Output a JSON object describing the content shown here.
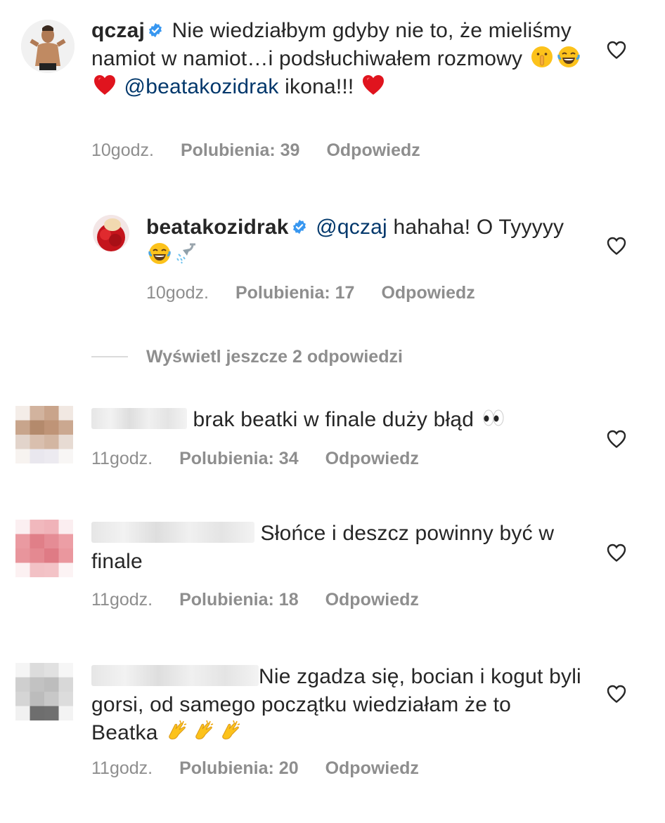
{
  "comments": [
    {
      "username": "qczaj",
      "text_before": " Nie wiedziałbym gdyby nie to, że mieliśmy namiot w namiot…i podsłuchiwałem rozmowy ",
      "mention": "@beatakozidrak",
      "text_after": " ikona!!! ",
      "time": "10godz.",
      "likes": "Polubienia: 39",
      "reply": "Odpowiedz"
    },
    {
      "username": "beatakozidrak",
      "mention": "@qczaj",
      "text_after": " hahaha! O Tyyyyy",
      "time": "10godz.",
      "likes": "Polubienia: 17",
      "reply": "Odpowiedz"
    },
    {
      "text": "brak beatki w finale duży błąd ",
      "time": "11godz.",
      "likes": "Polubienia: 34",
      "reply": "Odpowiedz"
    },
    {
      "text": "Słońce i deszcz powinny być w finale",
      "time": "11godz.",
      "likes": "Polubienia: 18",
      "reply": "Odpowiedz"
    },
    {
      "text": "Nie zgadza się,  bocian i kogut byli gorsi,  od samego początku wiedziałam że to Beatka ",
      "time": "11godz.",
      "likes": "Polubienia: 20",
      "reply": "Odpowiedz"
    }
  ],
  "view_more_replies": "Wyświetl jeszcze 2 odpowiedzi",
  "icons": [
    "verified-badge-icon",
    "heart-outline-icon",
    "shushing-face-emoji",
    "tears-of-joy-emoji",
    "red-heart-emoji",
    "shower-emoji",
    "eyes-emoji",
    "clapping-hands-emoji"
  ],
  "colors": {
    "text": "#262626",
    "secondary": "#8e8e8e",
    "mention": "#00376b",
    "verified": "#3897f0"
  }
}
